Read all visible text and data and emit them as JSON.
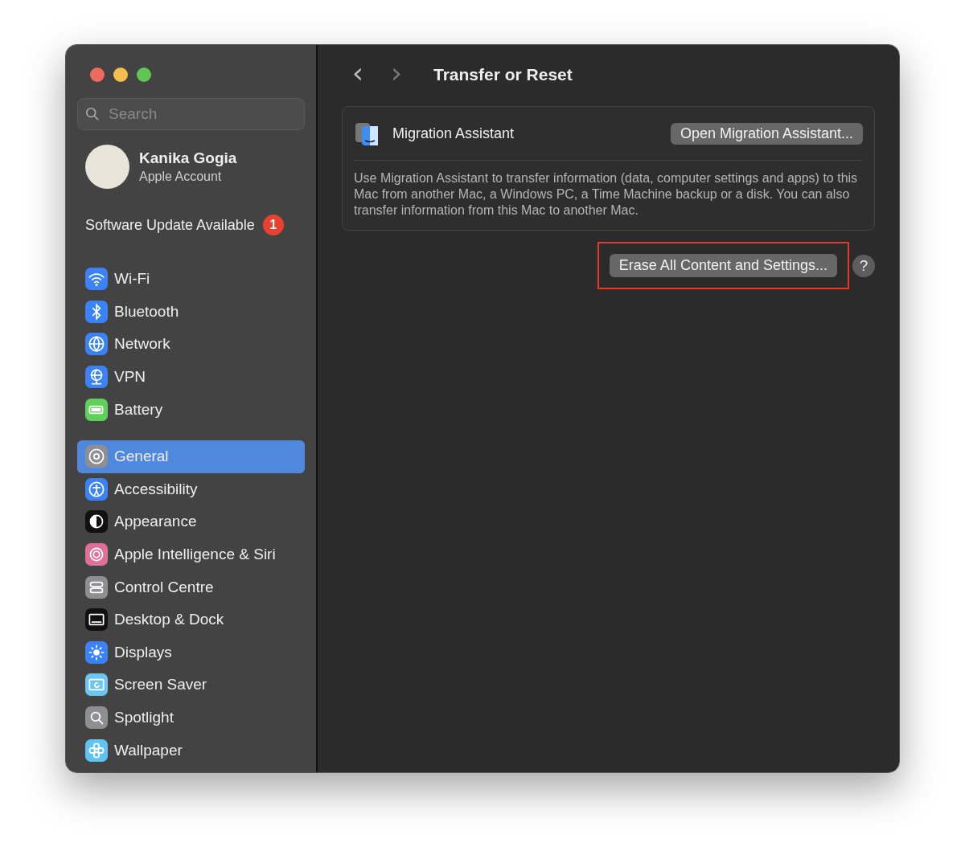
{
  "window": {
    "title": "Transfer or Reset",
    "back": "‹",
    "forward": "›"
  },
  "sidebar": {
    "search": {
      "placeholder": "Search"
    },
    "account": {
      "name": "Kanika Gogia",
      "subtitle": "Apple Account"
    },
    "update": {
      "label": "Software Update Available",
      "badge": "1"
    },
    "groups": [
      [
        {
          "label": "Wi-Fi",
          "color": "#3b82f6",
          "selected": false
        },
        {
          "label": "Bluetooth",
          "color": "#3b82f6",
          "selected": false
        },
        {
          "label": "Network",
          "color": "#3b82f6",
          "selected": false
        },
        {
          "label": "VPN",
          "color": "#3b82f6",
          "selected": false
        },
        {
          "label": "Battery",
          "color": "#5fd05c",
          "selected": false
        }
      ],
      [
        {
          "label": "General",
          "color": "#8e8e93",
          "selected": true
        },
        {
          "label": "Accessibility",
          "color": "#3b82f6",
          "selected": false
        },
        {
          "label": "Appearance",
          "color": "#111111",
          "selected": false
        },
        {
          "label": "Apple Intelligence & Siri",
          "color": "#e0709a",
          "selected": false
        },
        {
          "label": "Control Centre",
          "color": "#8e8e93",
          "selected": false
        },
        {
          "label": "Desktop & Dock",
          "color": "#111111",
          "selected": false
        },
        {
          "label": "Displays",
          "color": "#3b82f6",
          "selected": false
        },
        {
          "label": "Screen Saver",
          "color": "#6cc6f0",
          "selected": false
        },
        {
          "label": "Spotlight",
          "color": "#8e8e93",
          "selected": false
        },
        {
          "label": "Wallpaper",
          "color": "#5ec2f2",
          "selected": false
        }
      ]
    ]
  },
  "migration": {
    "title": "Migration Assistant",
    "button": "Open Migration Assistant...",
    "description": "Use Migration Assistant to transfer information (data, computer settings and apps) to this Mac from another Mac, a Windows PC, a Time Machine backup or a disk. You can also transfer information from this Mac to another Mac."
  },
  "erase": {
    "button": "Erase All Content and Settings...",
    "highlighted": true,
    "help": "?"
  }
}
